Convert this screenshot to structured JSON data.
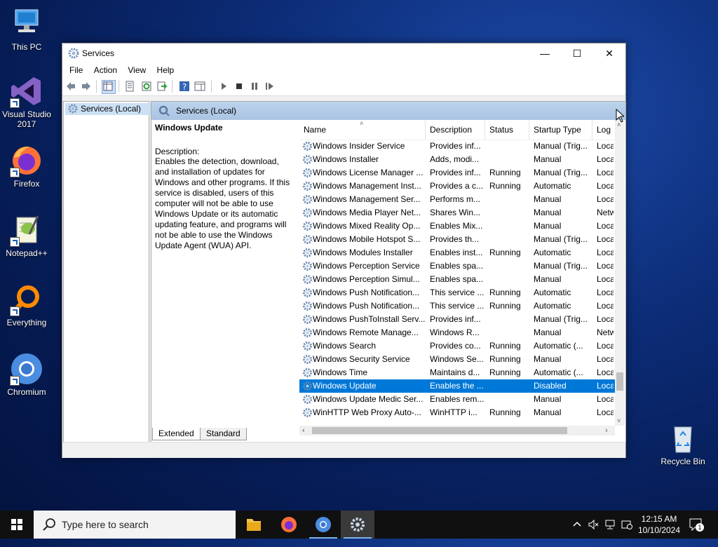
{
  "desktop": {
    "icons": [
      {
        "label": "This PC"
      },
      {
        "label": "Visual Studio 2017"
      },
      {
        "label": "Firefox"
      },
      {
        "label": "Notepad++"
      },
      {
        "label": "Everything"
      },
      {
        "label": "Chromium"
      },
      {
        "label": "Recycle Bin"
      }
    ]
  },
  "window": {
    "title": "Services",
    "menu": [
      "File",
      "Action",
      "View",
      "Help"
    ],
    "tree_item": "Services (Local)",
    "pane_header": "Services (Local)",
    "description": {
      "title": "Windows Update",
      "label": "Description:",
      "text": "Enables the detection, download, and installation of updates for Windows and other programs. If this service is disabled, users of this computer will not be able to use Windows Update or its automatic updating feature, and programs will not be able to use the Windows Update Agent (WUA) API."
    },
    "columns": [
      "Name",
      "Description",
      "Status",
      "Startup Type",
      "Log"
    ],
    "rows": [
      {
        "name": "Windows Insider Service",
        "desc": "Provides inf...",
        "status": "",
        "startup": "Manual (Trig...",
        "log": "Loca"
      },
      {
        "name": "Windows Installer",
        "desc": "Adds, modi...",
        "status": "",
        "startup": "Manual",
        "log": "Loca"
      },
      {
        "name": "Windows License Manager ...",
        "desc": "Provides inf...",
        "status": "Running",
        "startup": "Manual (Trig...",
        "log": "Loca"
      },
      {
        "name": "Windows Management Inst...",
        "desc": "Provides a c...",
        "status": "Running",
        "startup": "Automatic",
        "log": "Loca"
      },
      {
        "name": "Windows Management Ser...",
        "desc": "Performs m...",
        "status": "",
        "startup": "Manual",
        "log": "Loca"
      },
      {
        "name": "Windows Media Player Net...",
        "desc": "Shares Win...",
        "status": "",
        "startup": "Manual",
        "log": "Netw"
      },
      {
        "name": "Windows Mixed Reality Op...",
        "desc": "Enables Mix...",
        "status": "",
        "startup": "Manual",
        "log": "Loca"
      },
      {
        "name": "Windows Mobile Hotspot S...",
        "desc": "Provides th...",
        "status": "",
        "startup": "Manual (Trig...",
        "log": "Loca"
      },
      {
        "name": "Windows Modules Installer",
        "desc": "Enables inst...",
        "status": "Running",
        "startup": "Automatic",
        "log": "Loca"
      },
      {
        "name": "Windows Perception Service",
        "desc": "Enables spa...",
        "status": "",
        "startup": "Manual (Trig...",
        "log": "Loca"
      },
      {
        "name": "Windows Perception Simul...",
        "desc": "Enables spa...",
        "status": "",
        "startup": "Manual",
        "log": "Loca"
      },
      {
        "name": "Windows Push Notification...",
        "desc": "This service ...",
        "status": "Running",
        "startup": "Automatic",
        "log": "Loca"
      },
      {
        "name": "Windows Push Notification...",
        "desc": "This service ...",
        "status": "Running",
        "startup": "Automatic",
        "log": "Loca"
      },
      {
        "name": "Windows PushToInstall Serv...",
        "desc": "Provides inf...",
        "status": "",
        "startup": "Manual (Trig...",
        "log": "Loca"
      },
      {
        "name": "Windows Remote Manage...",
        "desc": "Windows R...",
        "status": "",
        "startup": "Manual",
        "log": "Netw"
      },
      {
        "name": "Windows Search",
        "desc": "Provides co...",
        "status": "Running",
        "startup": "Automatic (...",
        "log": "Loca"
      },
      {
        "name": "Windows Security Service",
        "desc": "Windows Se...",
        "status": "Running",
        "startup": "Manual",
        "log": "Loca"
      },
      {
        "name": "Windows Time",
        "desc": "Maintains d...",
        "status": "Running",
        "startup": "Automatic (...",
        "log": "Loca"
      },
      {
        "name": "Windows Update",
        "desc": "Enables the ...",
        "status": "",
        "startup": "Disabled",
        "log": "Loca",
        "selected": true
      },
      {
        "name": "Windows Update Medic Ser...",
        "desc": "Enables rem...",
        "status": "",
        "startup": "Manual",
        "log": "Loca"
      },
      {
        "name": "WinHTTP Web Proxy Auto-...",
        "desc": "WinHTTP i...",
        "status": "Running",
        "startup": "Manual",
        "log": "Loca"
      }
    ],
    "tabs": [
      "Extended",
      "Standard"
    ]
  },
  "taskbar": {
    "search_placeholder": "Type here to search",
    "time": "12:15 AM",
    "date": "10/10/2024",
    "notification_count": "1"
  },
  "colors": {
    "selection": "#0078d7",
    "header_band": "#b4cce9"
  }
}
